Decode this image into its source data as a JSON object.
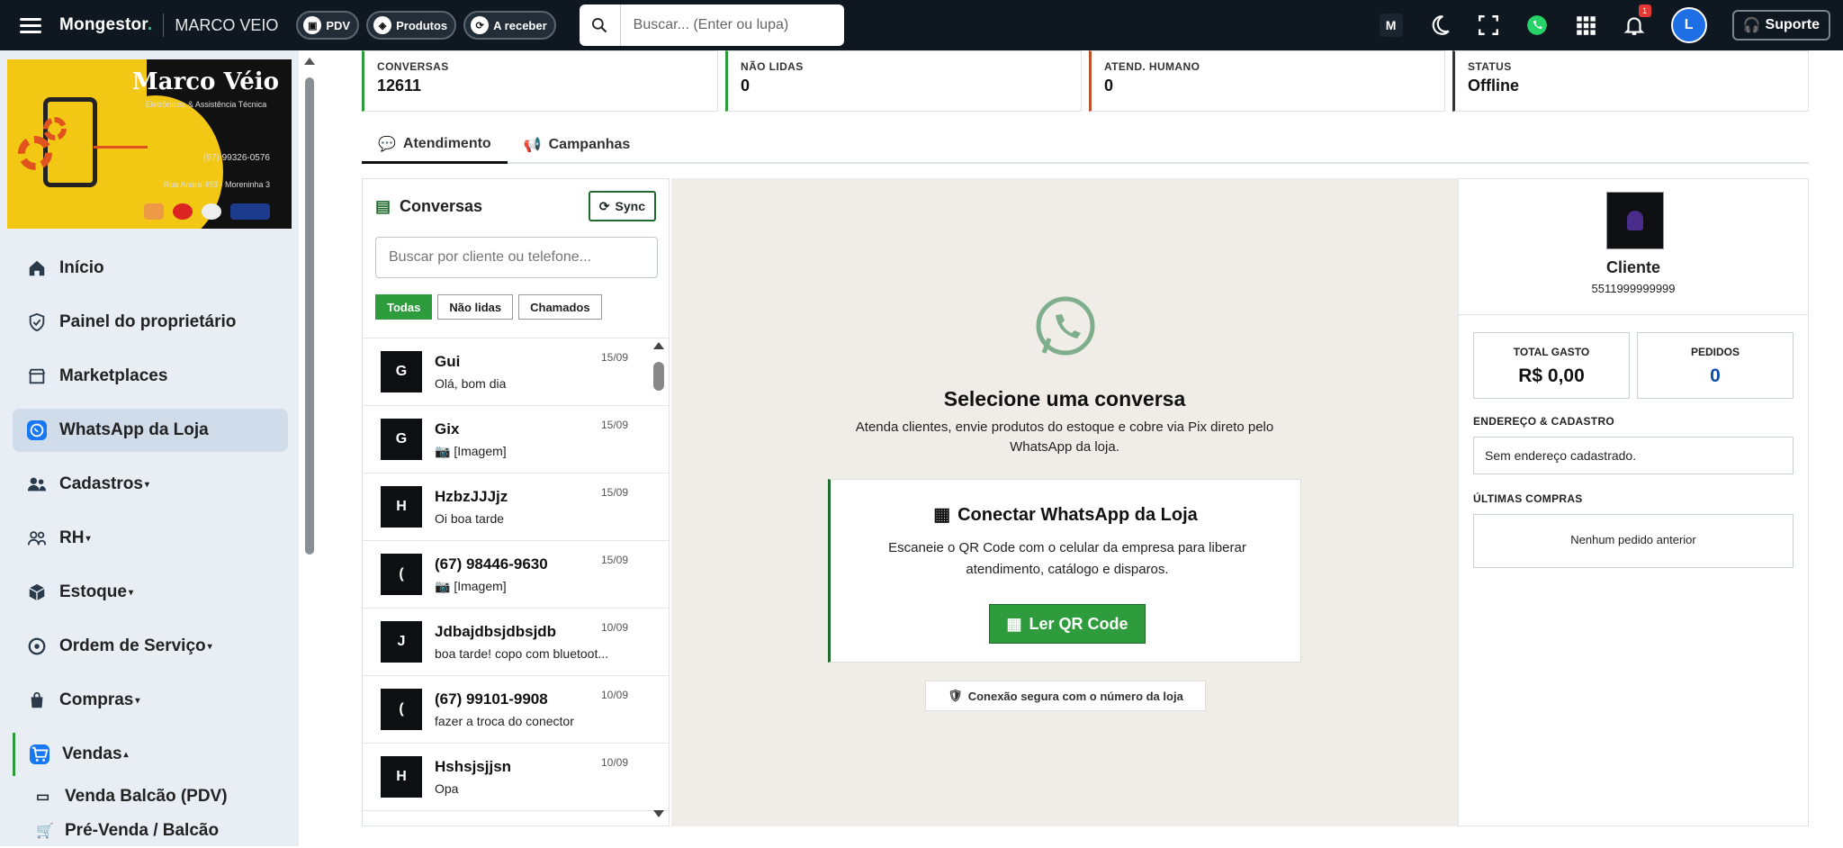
{
  "app": {
    "brand": "Mongestor",
    "brand_dot": ".",
    "shop_name": "MARCO VEIO"
  },
  "pills": [
    {
      "label": "PDV"
    },
    {
      "label": "Produtos"
    },
    {
      "label": "A receber"
    }
  ],
  "search": {
    "placeholder": "Buscar... (Enter ou lupa)"
  },
  "topbar": {
    "m_badge": "M",
    "notif_count": "1",
    "avatar_letter": "L",
    "support_label": "Suporte"
  },
  "logo": {
    "name": "Marco Véio",
    "subtitle": "Eletrônicos & Assistência Técnica",
    "phone": "(67) 99326-0576",
    "address": "Rua Anara 493 - Moreninha 3"
  },
  "sidebar": {
    "items": [
      {
        "label": "Início",
        "icon": "home-icon"
      },
      {
        "label": "Painel do proprietário",
        "icon": "shield-icon"
      },
      {
        "label": "Marketplaces",
        "icon": "store-icon"
      },
      {
        "label": "WhatsApp da Loja",
        "icon": "whatsapp-icon"
      },
      {
        "label": "Cadastros",
        "icon": "users-icon"
      },
      {
        "label": "RH",
        "icon": "team-icon"
      },
      {
        "label": "Estoque",
        "icon": "box-icon"
      },
      {
        "label": "Ordem de Serviço",
        "icon": "wrench-icon"
      },
      {
        "label": "Compras",
        "icon": "bag-icon"
      },
      {
        "label": "Vendas",
        "icon": "cart-icon"
      }
    ],
    "subitems": [
      {
        "label": "Venda Balcão (PDV)"
      },
      {
        "label": "Pré-Venda / Balcão"
      }
    ]
  },
  "stats": [
    {
      "label": "CONVERSAS",
      "value": "12611"
    },
    {
      "label": "NÃO LIDAS",
      "value": "0"
    },
    {
      "label": "ATEND. HUMANO",
      "value": "0"
    },
    {
      "label": "STATUS",
      "value": "Offline"
    }
  ],
  "tabs": [
    {
      "label": "Atendimento"
    },
    {
      "label": "Campanhas"
    }
  ],
  "conversations": {
    "title": "Conversas",
    "sync_label": "Sync",
    "search_placeholder": "Buscar por cliente ou telefone...",
    "filters": [
      "Todas",
      "Não lidas",
      "Chamados"
    ],
    "items": [
      {
        "initial": "G",
        "name": "Gui",
        "date": "15/09",
        "message": "Olá, bom dia"
      },
      {
        "initial": "G",
        "name": "Gix",
        "date": "15/09",
        "message": "📷 [Imagem]"
      },
      {
        "initial": "H",
        "name": "HzbzJJJjz",
        "date": "15/09",
        "message": "Oi boa tarde"
      },
      {
        "initial": "(",
        "name": "(67) 98446-9630",
        "date": "15/09",
        "message": "📷 [Imagem]"
      },
      {
        "initial": "J",
        "name": "Jdbajdbsjdbsjdb",
        "date": "10/09",
        "message": "boa tarde! copo com bluetoot..."
      },
      {
        "initial": "(",
        "name": "(67) 99101-9908",
        "date": "10/09",
        "message": "fazer a troca do conector"
      },
      {
        "initial": "H",
        "name": "Hshsjsjjsn",
        "date": "10/09",
        "message": "Opa"
      }
    ]
  },
  "center": {
    "title": "Selecione uma conversa",
    "subtitle": "Atenda clientes, envie produtos do estoque e cobre via Pix direto pelo WhatsApp da loja.",
    "card_title": "Conectar WhatsApp da Loja",
    "card_text": "Escaneie o QR Code com o celular da empresa para liberar atendimento, catálogo e disparos.",
    "button": "Ler QR Code",
    "secure": "Conexão segura com o número da loja"
  },
  "client": {
    "name": "Cliente",
    "phone": "5511999999999",
    "total_label": "TOTAL GASTO",
    "total_value": "R$ 0,00",
    "orders_label": "PEDIDOS",
    "orders_value": "0",
    "address_label": "ENDEREÇO & CADASTRO",
    "address_value": "Sem endereço cadastrado.",
    "purchases_label": "ÚLTIMAS COMPRAS",
    "purchases_value": "Nenhum pedido anterior"
  },
  "colors": {
    "topbar": "#0f1821",
    "accent_green": "#2e9c3c",
    "primary_blue": "#1877f2",
    "center_bg": "#f0ede8"
  }
}
